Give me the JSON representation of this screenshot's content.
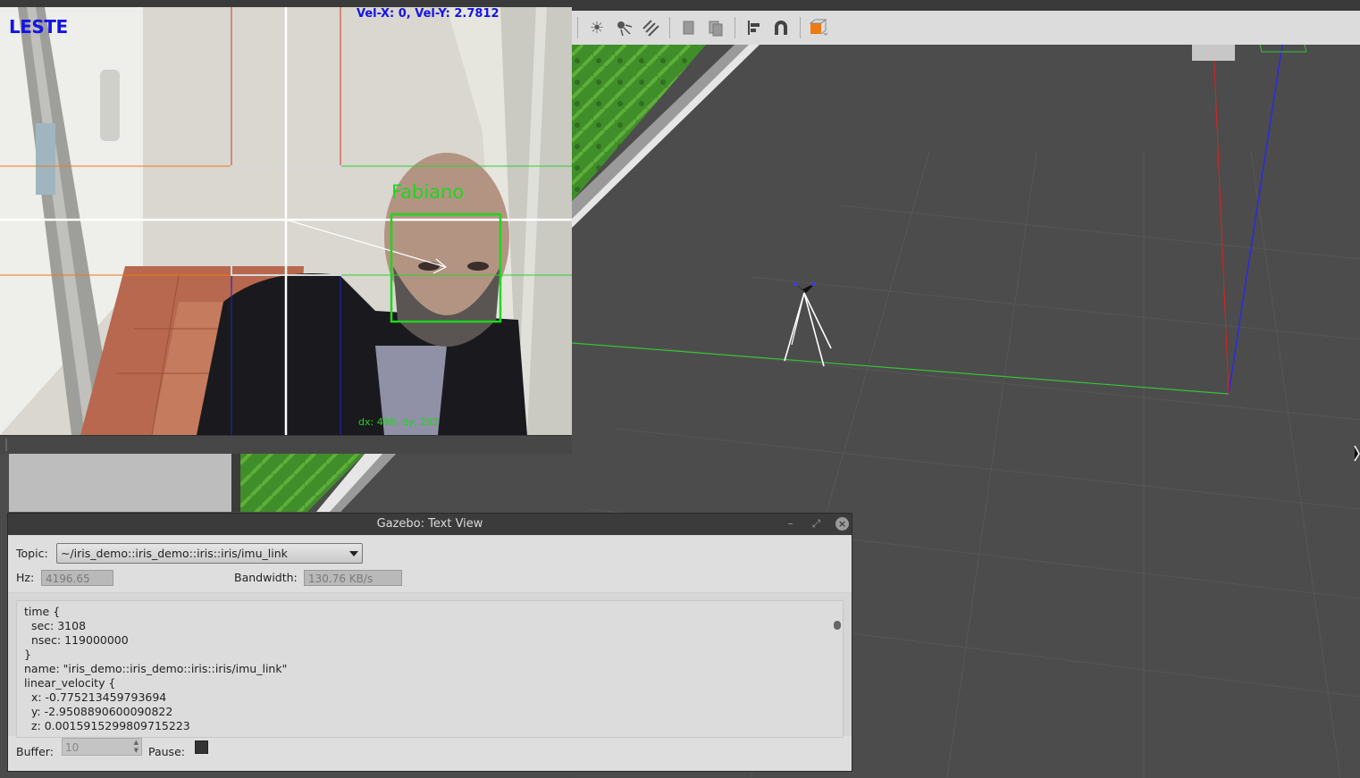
{
  "camera": {
    "direction": "LESTE",
    "velocity": "Vel-X: 0, Vel-Y: 2.7812",
    "face_name": "Fabiano",
    "offset": "dx: 498, dy: 292"
  },
  "toolbar": {
    "icons": [
      "sun-light-icon",
      "point-light-icon",
      "directional-light-icon",
      "copy-icon",
      "paste-icon",
      "align-icon",
      "magnet-snap-icon",
      "view-angle-icon"
    ]
  },
  "text_view": {
    "title": "Gazebo: Text View",
    "topic_label": "Topic:",
    "topic_value": "~/iris_demo::iris_demo::iris::iris/imu_link",
    "hz_label": "Hz:",
    "hz_value": "4196.65",
    "bandwidth_label": "Bandwidth:",
    "bandwidth_value": "130.76 KB/s",
    "message": "time {\n  sec: 3108\n  nsec: 119000000\n}\nname: \"iris_demo::iris_demo::iris::iris/imu_link\"\nlinear_velocity {\n  x: -0.775213459793694\n  y: -2.9508890600090822\n  z: 0.0015915299809715223",
    "buffer_label": "Buffer:",
    "buffer_value": "10",
    "pause_label": "Pause:"
  },
  "colors": {
    "face_box": "#1fd61f",
    "overlay_text_blue": "#1414e6",
    "gazebo_toolbar": "#dcdcdc",
    "viewport_bg": "#4c4c4c"
  }
}
